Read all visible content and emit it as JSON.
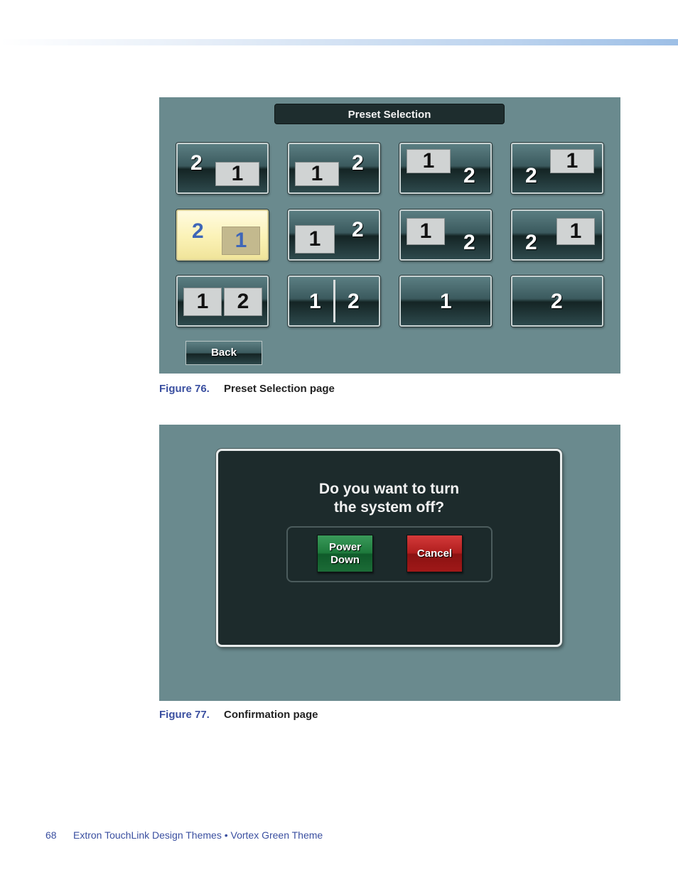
{
  "figure76": {
    "title": "Preset Selection",
    "back_label": "Back",
    "caption_label": "Figure 76.",
    "caption_text": "Preset Selection page"
  },
  "figure77": {
    "question_line1": "Do you want to turn",
    "question_line2": "the system off?",
    "power_line1": "Power",
    "power_line2": "Down",
    "cancel_label": "Cancel",
    "caption_label": "Figure 77.",
    "caption_text": "Confirmation page"
  },
  "tiles": {
    "t1": {
      "large": "2",
      "box": "1"
    },
    "t2": {
      "large": "2",
      "box": "1"
    },
    "t3": {
      "large": "2",
      "box": "1"
    },
    "t4": {
      "large": "2",
      "box": "1"
    },
    "t5": {
      "large": "2",
      "box": "1",
      "selected": true
    },
    "t6": {
      "large": "2",
      "box": "1"
    },
    "t7": {
      "large": "2",
      "box": "1"
    },
    "t8": {
      "large": "2",
      "box": "1"
    },
    "t9": {
      "left": "1",
      "right": "2"
    },
    "t10": {
      "left": "1",
      "right": "2"
    },
    "t11": {
      "single": "1"
    },
    "t12": {
      "single": "2"
    }
  },
  "footer": {
    "page_number": "68",
    "doc_title": "Extron TouchLink Design Themes • Vortex Green Theme"
  },
  "colors": {
    "panel_bg": "#6a8a8e",
    "caption_accent": "#3a4fa0",
    "power_button": "#1e7a3c",
    "cancel_button": "#b01e1e",
    "selected_tile": "#fbf2b6"
  }
}
